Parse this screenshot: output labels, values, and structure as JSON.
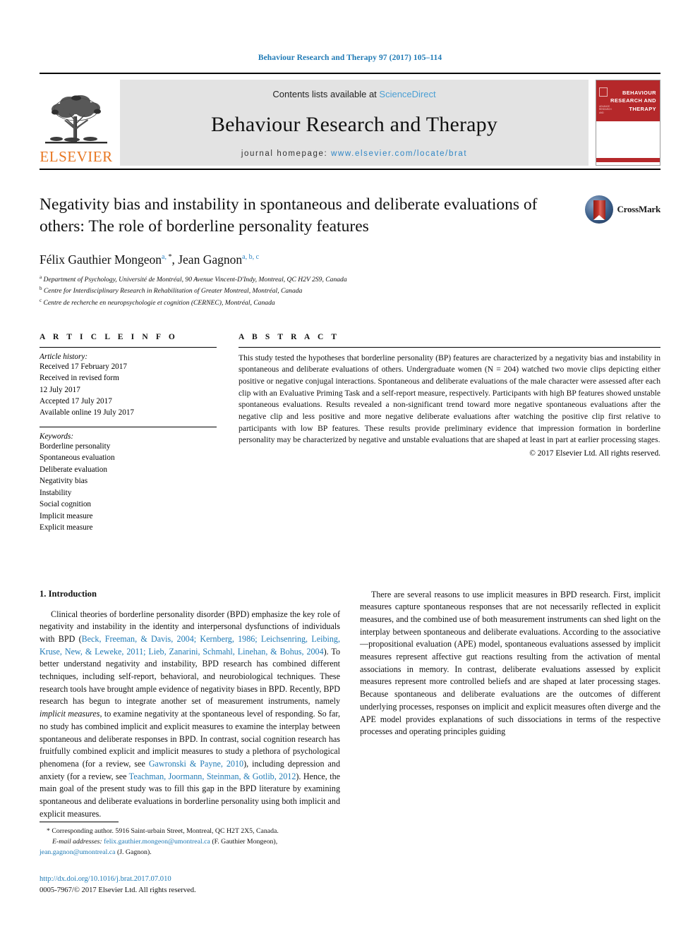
{
  "running_head": "Behaviour Research and Therapy 97 (2017) 105–114",
  "masthead": {
    "elsevier_wordmark": "ELSEVIER",
    "contents_prefix": "Contents lists available at ",
    "contents_link": "ScienceDirect",
    "journal_title": "Behaviour Research and Therapy",
    "homepage_prefix": "journal homepage: ",
    "homepage_url": "www.elsevier.com/locate/brat",
    "cover_title_line1": "BEHAVIOUR",
    "cover_title_line2": "RESEARCH AND",
    "cover_title_line3": "THERAPY",
    "accent_red": "#b5282a",
    "accent_orange": "#E87722",
    "link_blue": "#2f86c5"
  },
  "article": {
    "title": "Negativity bias and instability in spontaneous and deliberate evaluations of others: The role of borderline personality features",
    "crossmark_label": "CrossMark",
    "authors_html": "Félix Gauthier Mongeon <sup>a, *</sup>, Jean Gagnon <sup>a, b, c</sup>",
    "authors_plain": "Félix Gauthier Mongeon a, *, Jean Gagnon a, b, c",
    "affiliations": [
      {
        "mark": "a",
        "text": "Department of Psychology, Université de Montréal, 90 Avenue Vincent-D'Indy, Montreal, QC H2V 2S9, Canada"
      },
      {
        "mark": "b",
        "text": "Centre for Interdisciplinary Research in Rehabilitation of Greater Montreal, Montréal, Canada"
      },
      {
        "mark": "c",
        "text": "Centre de recherche en neuropsychologie et cognition (CERNEC), Montréal, Canada"
      }
    ]
  },
  "article_info": {
    "heading": "A R T I C L E  I N F O",
    "history_label": "Article history:",
    "history": [
      "Received 17 February 2017",
      "Received in revised form",
      "12 July 2017",
      "Accepted 17 July 2017",
      "Available online 19 July 2017"
    ],
    "keywords_label": "Keywords:",
    "keywords": [
      "Borderline personality",
      "Spontaneous evaluation",
      "Deliberate evaluation",
      "Negativity bias",
      "Instability",
      "Social cognition",
      "Implicit measure",
      "Explicit measure"
    ]
  },
  "abstract": {
    "heading": "A B S T R A C T",
    "body": "This study tested the hypotheses that borderline personality (BP) features are characterized by a negativity bias and instability in spontaneous and deliberate evaluations of others. Undergraduate women (N = 204) watched two movie clips depicting either positive or negative conjugal interactions. Spontaneous and deliberate evaluations of the male character were assessed after each clip with an Evaluative Priming Task and a self-report measure, respectively. Participants with high BP features showed unstable spontaneous evaluations. Results revealed a non-significant trend toward more negative spontaneous evaluations after the negative clip and less positive and more negative deliberate evaluations after watching the positive clip first relative to participants with low BP features. These results provide preliminary evidence that impression formation in borderline personality may be characterized by negative and unstable evaluations that are shaped at least in part at earlier processing stages.",
    "copyright": "© 2017 Elsevier Ltd. All rights reserved."
  },
  "body": {
    "section_number_title": "1. Introduction",
    "left_paragraph_1": {
      "t1": "Clinical theories of borderline personality disorder (BPD) emphasize the key role of negativity and instability in the identity and interpersonal dysfunctions of individuals with BPD (",
      "ref1": "Beck, Freeman, & Davis, 2004; Kernberg, 1986; Leichsenring, Leibing, Kruse, New, & Leweke, 2011; Lieb, Zanarini, Schmahl, Linehan, & Bohus, 2004",
      "t2": "). To better understand negativity and instability, BPD research has combined different techniques, including self-report, behavioral, and neurobiological techniques. These research tools have brought ample evidence of negativity biases in BPD. Recently, BPD research has begun to integrate another set of measurement instruments, namely ",
      "ital1": "implicit measures",
      "t3": ", to examine negativity at the spontaneous level of responding. So far, no study has combined implicit and explicit measures to examine the interplay between spontaneous and deliberate responses in BPD. In contrast, social cognition research has fruitfully combined explicit and implicit measures to study a plethora of psychological phenomena (for a review, see ",
      "ref2": "Gawronski & Payne, 2010",
      "t4": "), including depression and anxiety (for a review, see ",
      "ref3": "Teachman, Joormann, Steinman, & Gotlib, 2012",
      "t5": "). Hence, the main goal of the present study was to fill this gap in the BPD literature by examining spontaneous and deliberate evaluations in borderline personality using both implicit and explicit measures."
    },
    "right_paragraph_2": "There are several reasons to use implicit measures in BPD research. First, implicit measures capture spontaneous responses that are not necessarily reflected in explicit measures, and the combined use of both measurement instruments can shed light on the interplay between spontaneous and deliberate evaluations. According to the associative—propositional evaluation (APE) model, spontaneous evaluations assessed by implicit measures represent affective gut reactions resulting from the activation of mental associations in memory. In contrast, deliberate evaluations assessed by explicit measures represent more controlled beliefs and are shaped at later processing stages. Because spontaneous and deliberate evaluations are the outcomes of different underlying processes, responses on implicit and explicit measures often diverge and the APE model provides explanations of such dissociations in terms of the respective processes and operating principles guiding"
  },
  "footnote": {
    "star": "*",
    "corresponding": "Corresponding author. 5916 Saint-urbain Street, Montreal, QC H2T 2X5, Canada.",
    "email_label": "E-mail addresses:",
    "email1": "felix.gauthier.mongeon@umontreal.ca",
    "email1_name": "(F. Gauthier Mongeon),",
    "email2": "jean.gagnon@umontreal.ca",
    "email2_name": "(J. Gagnon).",
    "doi": "http://dx.doi.org/10.1016/j.brat.2017.07.010",
    "issn_copyright": "0005-7967/© 2017 Elsevier Ltd. All rights reserved."
  }
}
